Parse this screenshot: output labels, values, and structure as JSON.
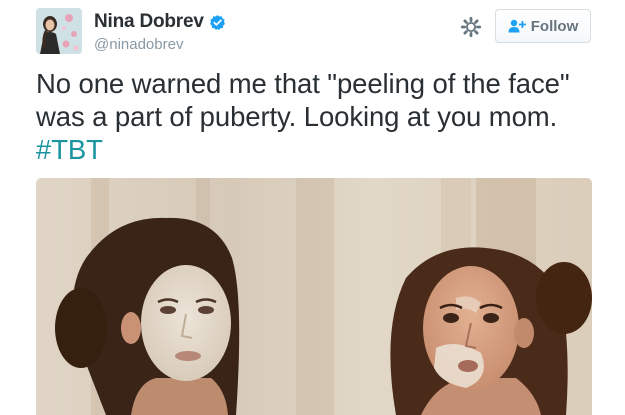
{
  "user": {
    "display_name": "Nina Dobrev",
    "handle": "@ninadobrev",
    "verified": true
  },
  "actions": {
    "follow_label": "Follow",
    "settings_icon": "gear-icon",
    "follow_icon": "person-plus-icon"
  },
  "tweet": {
    "line1": "No one warned me that \"peeling of the face\"",
    "line2": "was a part of puberty. Looking at you mom.",
    "hashtag": "#TBT"
  },
  "colors": {
    "text": "#292f33",
    "muted": "#8899a6",
    "hashtag": "#1b95a0",
    "verified": "#1da1f2",
    "button_text": "#66757f"
  }
}
